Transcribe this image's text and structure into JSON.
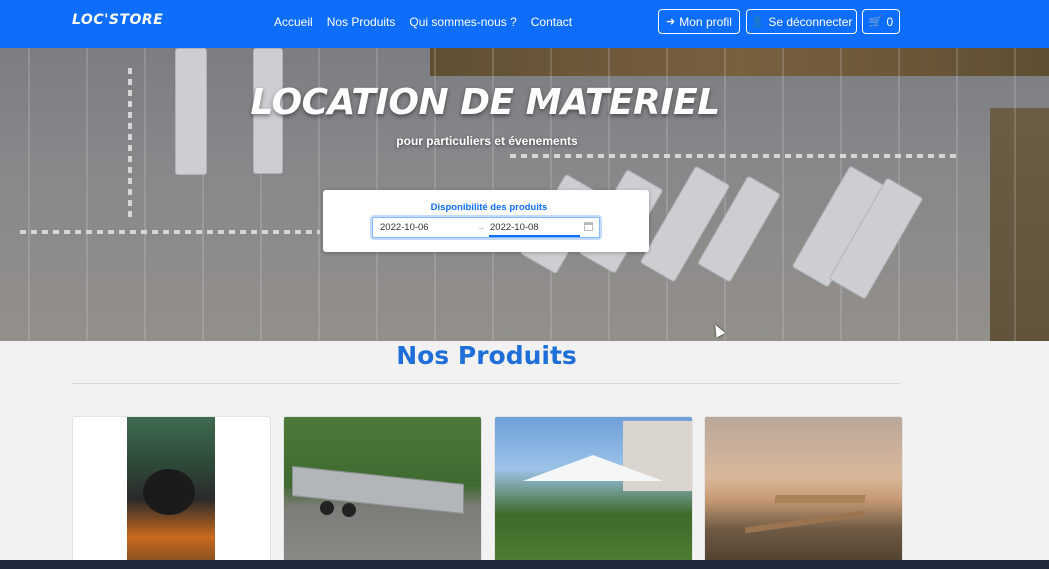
{
  "navbar": {
    "brand": "LOC'STORE",
    "links": [
      "Accueil",
      "Nos Produits",
      "Qui sommes-nous ?",
      "Contact"
    ],
    "profile_label": "Mon profil",
    "logout_label": "Se déconnecter",
    "cart_count": "0",
    "color": "#0d6efd"
  },
  "hero": {
    "title": "LOCATION DE MATERIEL",
    "subtitle": "pour particuliers et évenements",
    "availability": {
      "title": "Disponibilité des produits",
      "start_date": "2022-10-06",
      "end_date": "2022-10-08"
    }
  },
  "products": {
    "title": "Nos Produits",
    "items": [
      {
        "image": "cooking-pot-over-fire"
      },
      {
        "image": "car-trailer"
      },
      {
        "image": "white-party-tent"
      },
      {
        "image": "picnic-table-by-lake"
      }
    ]
  },
  "icons": {
    "profile": "sign-in-icon",
    "logout": "user-plus-icon",
    "cart": "cart-icon",
    "calendar": "calendar-icon"
  }
}
